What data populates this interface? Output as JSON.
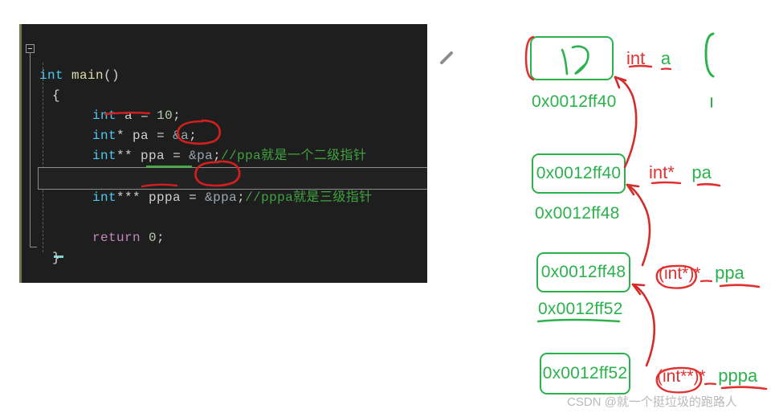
{
  "editor": {
    "background_color": "#1e1e1e",
    "lines": [
      {
        "id": "line-main",
        "text": "int main()"
      },
      {
        "id": "line-open",
        "text": "{"
      },
      {
        "id": "line-a",
        "text": "int a = 10;"
      },
      {
        "id": "line-pa",
        "text": "int* pa = &a;"
      },
      {
        "id": "line-ppa",
        "text": "int** ppa = &pa;//ppa就是一个二级指针"
      },
      {
        "id": "line-blank",
        "text": ""
      },
      {
        "id": "line-pppa",
        "text": "int*** pppa = &ppa;//pppa就是三级指针"
      },
      {
        "id": "line-return",
        "text": "return 0;"
      },
      {
        "id": "line-close",
        "text": "}"
      }
    ],
    "tokens": {
      "kw_int": "int",
      "fn_main": "main",
      "paren": "()",
      "brace_open": "{",
      "brace_close": "}",
      "var_a": "a",
      "var_pa": "pa",
      "var_ppa": "ppa",
      "var_pppa": "pppa",
      "num_10": "10",
      "assign": "=",
      "semi": ";",
      "star1": "*",
      "star2": "**",
      "star3": "***",
      "amp_a": "&a",
      "amp_pa": "&pa",
      "amp_ppa": "&ppa",
      "kw_return": "return",
      "num_0": "0",
      "comment_ppa": "//ppa就是一个二级指针",
      "comment_pppa": "//pppa就是三级指针"
    },
    "colors": {
      "keyword": "#4ec9f0",
      "function": "#dcdcaa",
      "comment": "#3fa33f",
      "number": "#b5cea8",
      "variable": "#cfcfcf",
      "return_keyword": "#c586c0"
    },
    "annotations": {
      "underline_pa": "red underline under pa",
      "underline_pppa": "red underline under pppa",
      "circle_amp_pa": "red circle around &pa;",
      "circle_amp_ppa": "red circle around &ppa;",
      "green_squiggle": "green squiggly under ppa assignment",
      "current_line_highlight": "gray bordered empty line"
    }
  },
  "diagram": {
    "boxes": [
      {
        "id": "box-a",
        "value": "10",
        "address_below": "0x0012ff40"
      },
      {
        "id": "box-pa",
        "value": "0x0012ff40",
        "address_below": "0x0012ff48"
      },
      {
        "id": "box-ppa",
        "value": "0x0012ff48",
        "address_below": "0x0012ff52"
      },
      {
        "id": "box-pppa",
        "value": "0x0012ff52",
        "address_below": ""
      }
    ],
    "labels": [
      {
        "id": "label-a",
        "type_text": "int",
        "var_text": "a"
      },
      {
        "id": "label-pa",
        "type_text": "int*",
        "var_text": "pa"
      },
      {
        "id": "label-ppa",
        "type_text": "(int*)*",
        "var_text": "ppa"
      },
      {
        "id": "label-pppa",
        "type_text": "(int**)*",
        "var_text": "pppa"
      }
    ],
    "arrows": [
      {
        "id": "arrow-pa-to-a",
        "from": "box-pa",
        "to": "box-a"
      },
      {
        "id": "arrow-ppa-to-pa",
        "from": "box-ppa",
        "to": "box-pa"
      },
      {
        "id": "arrow-pppa-to-ppa",
        "from": "box-pppa",
        "to": "box-ppa"
      }
    ],
    "colors": {
      "box_green": "#2bb24c",
      "annotation_red": "#e03030",
      "background": "#ffffff"
    }
  },
  "watermark": {
    "text": "CSDN @就一个挺垃圾的跑路人"
  }
}
